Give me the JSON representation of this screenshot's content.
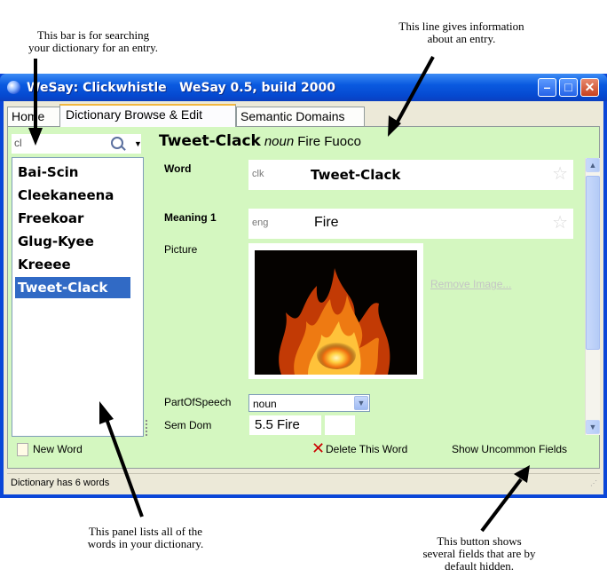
{
  "annotations": {
    "search_note": "This bar is for searching\nyour dictionary for an entry.",
    "info_note": "This line gives information\nabout an entry.",
    "panel_note": "This panel lists all of the\nwords in your dictionary.",
    "button_note": "This button shows\nseveral fields that are by\ndefault hidden."
  },
  "window": {
    "title": "WeSay: Clickwhistle",
    "version": "WeSay 0.5, build 2000"
  },
  "tabs": [
    {
      "label": "Home"
    },
    {
      "label": "Dictionary Browse & Edit",
      "active": true
    },
    {
      "label": "Semantic Domains"
    }
  ],
  "search": {
    "value": "cl"
  },
  "word_list": [
    "Bai-Scin",
    "Cleekaneena",
    "Freekoar",
    "Glug-Kyee",
    "Kreeee",
    "Tweet-Clack"
  ],
  "selected_word": "Tweet-Clack",
  "entry": {
    "headword": "Tweet-Clack",
    "pos": "noun",
    "glosses": "Fire Fuoco",
    "word_label": "Word",
    "word_ws": "clk",
    "word_value": "Tweet-Clack",
    "meaning_label": "Meaning 1",
    "meaning_ws": "eng",
    "meaning_value": "Fire",
    "picture_label": "Picture",
    "remove_image": "Remove Image...",
    "pos_label": "PartOfSpeech",
    "pos_value": "noun",
    "semdom_label": "Sem Dom",
    "semdom_value": "5.5 Fire"
  },
  "actions": {
    "new_word": "New Word",
    "delete_word": "Delete This Word",
    "show_uncommon": "Show Uncommon Fields"
  },
  "status": "Dictionary has 6 words",
  "colors": {
    "panel": "#d4f7c0",
    "selection": "#316ac5",
    "titlebar": "#0a5ae0"
  }
}
